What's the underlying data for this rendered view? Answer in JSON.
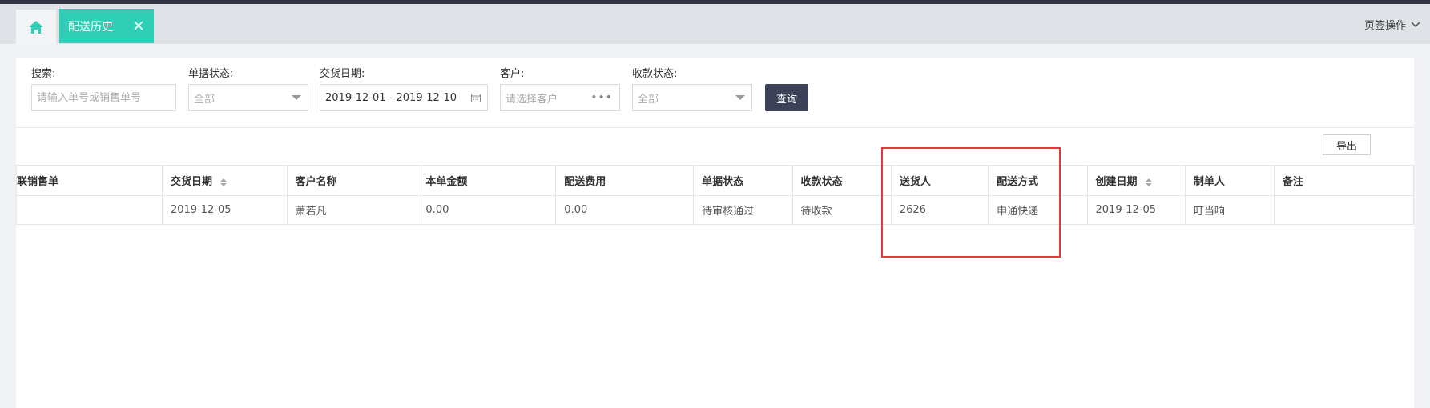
{
  "tabs": {
    "home_icon": "home-icon",
    "active_label": "配送历史",
    "ops_label": "页签操作"
  },
  "filters": {
    "search": {
      "label": "搜索:",
      "placeholder": "请输入单号或销售单号"
    },
    "doc_status": {
      "label": "单据状态:",
      "value": "全部"
    },
    "delivery_date": {
      "label": "交货日期:",
      "value": "2019-12-01 - 2019-12-10"
    },
    "customer": {
      "label": "客户:",
      "placeholder": "请选择客户"
    },
    "payment_status": {
      "label": "收款状态:",
      "value": "全部"
    },
    "query_label": "查询"
  },
  "toolbar": {
    "export_label": "导出"
  },
  "table": {
    "headers": [
      "联销售单",
      "交货日期",
      "客户名称",
      "本单金额",
      "配送费用",
      "单据状态",
      "收款状态",
      "送货人",
      "配送方式",
      "创建日期",
      "制单人",
      "备注"
    ],
    "rows": [
      [
        "",
        "2019-12-05",
        "萧若凡",
        "0.00",
        "0.00",
        "待审核通过",
        "待收款",
        "2626",
        "申通快递",
        "2019-12-05",
        "叮当响",
        ""
      ]
    ]
  },
  "colors": {
    "accent": "#2ecfb5",
    "button_dark": "#3b4257",
    "highlight": "#e33b3b"
  }
}
